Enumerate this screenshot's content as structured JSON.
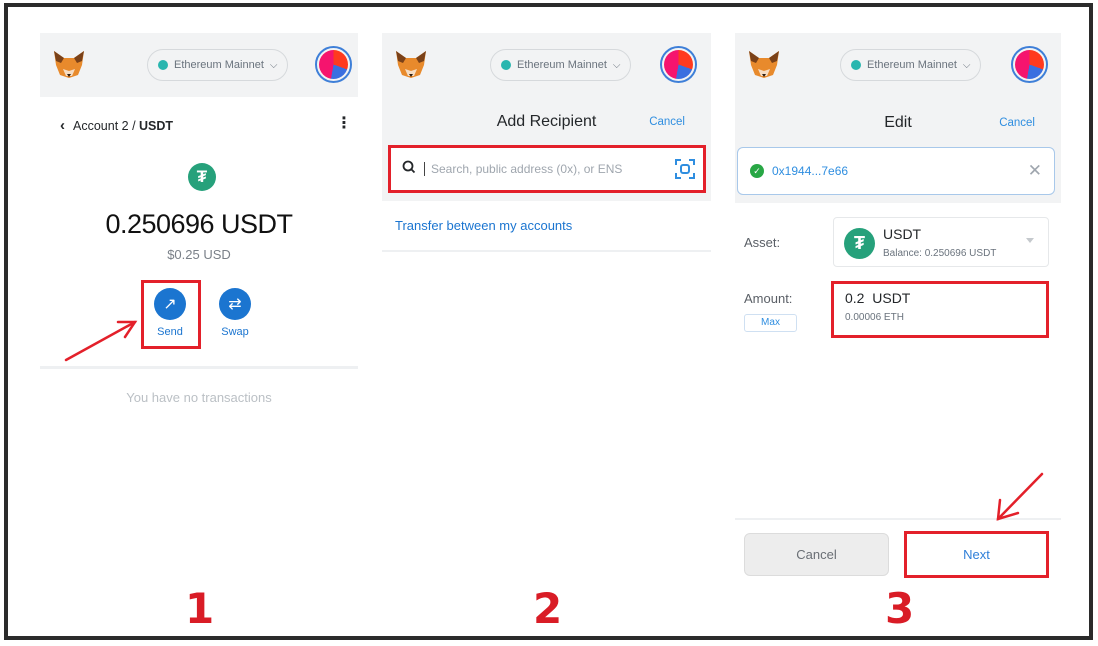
{
  "network": {
    "label": "Ethereum Mainnet",
    "dot_color": "#29b6af"
  },
  "accent_color": "#1b75d0",
  "highlight_color": "#e3202a",
  "step1": {
    "breadcrumb_account": "Account 2 / ",
    "breadcrumb_token": "USDT",
    "token_icon": "tether-icon",
    "token_glyph": "₮",
    "balance": "0.250696 USDT",
    "fiat_balance": "$0.25 USD",
    "actions": [
      {
        "label": "Send",
        "icon": "arrow-up-right-icon",
        "glyph": "↗"
      },
      {
        "label": "Swap",
        "icon": "swap-icon",
        "glyph": "⇄"
      }
    ],
    "empty_text": "You have no transactions",
    "step_number": "1"
  },
  "step2": {
    "title": "Add Recipient",
    "cancel_label": "Cancel",
    "search_placeholder": "Search, public address (0x), or ENS",
    "transfer_link": "Transfer between my accounts",
    "step_number": "2"
  },
  "step3": {
    "title": "Edit",
    "cancel_label": "Cancel",
    "recipient_address": "0x1944...7e66",
    "asset_label": "Asset:",
    "asset_symbol": "USDT",
    "asset_balance": "Balance: 0.250696 USDT",
    "amount_label": "Amount:",
    "max_label": "Max",
    "amount_value": "0.2  USDT",
    "amount_secondary": "0.00006 ETH",
    "cancel_button": "Cancel",
    "next_button": "Next",
    "step_number": "3"
  }
}
